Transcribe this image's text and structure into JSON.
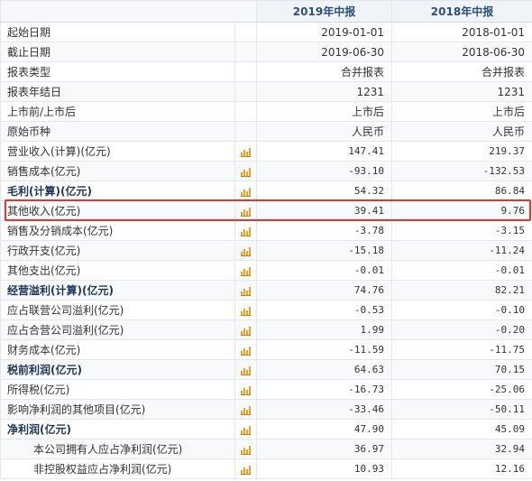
{
  "header": {
    "col1": "2019年中报",
    "col2": "2018年中报"
  },
  "rows": [
    {
      "label": "起始日期",
      "v1": "2019-01-01",
      "v2": "2018-01-01",
      "icon": false,
      "bold": false
    },
    {
      "label": "截止日期",
      "v1": "2019-06-30",
      "v2": "2018-06-30",
      "icon": false,
      "bold": false
    },
    {
      "label": "报表类型",
      "v1": "合并报表",
      "v2": "合并报表",
      "icon": false,
      "bold": false
    },
    {
      "label": "报表年结日",
      "v1": "1231",
      "v2": "1231",
      "icon": false,
      "bold": false
    },
    {
      "label": "上市前/上市后",
      "v1": "上市后",
      "v2": "上市后",
      "icon": false,
      "bold": false
    },
    {
      "label": "原始币种",
      "v1": "人民币",
      "v2": "人民币",
      "icon": false,
      "bold": false
    },
    {
      "label": "营业收入(计算)(亿元)",
      "v1": "147.41",
      "v2": "219.37",
      "icon": true,
      "bold": false
    },
    {
      "label": "销售成本(亿元)",
      "v1": "-93.10",
      "v2": "-132.53",
      "icon": true,
      "bold": false
    },
    {
      "label": "毛利(计算)(亿元)",
      "v1": "54.32",
      "v2": "86.84",
      "icon": true,
      "bold": true
    },
    {
      "label": "其他收入(亿元)",
      "v1": "39.41",
      "v2": "9.76",
      "icon": true,
      "bold": false
    },
    {
      "label": "销售及分销成本(亿元)",
      "v1": "-3.78",
      "v2": "-3.15",
      "icon": true,
      "bold": false
    },
    {
      "label": "行政开支(亿元)",
      "v1": "-15.18",
      "v2": "-11.24",
      "icon": true,
      "bold": false
    },
    {
      "label": "其他支出(亿元)",
      "v1": "-0.01",
      "v2": "-0.01",
      "icon": true,
      "bold": false
    },
    {
      "label": "经营溢利(计算)(亿元)",
      "v1": "74.76",
      "v2": "82.21",
      "icon": true,
      "bold": true
    },
    {
      "label": "应占联营公司溢利(亿元)",
      "v1": "-0.53",
      "v2": "-0.10",
      "icon": true,
      "bold": false
    },
    {
      "label": "应占合营公司溢利(亿元)",
      "v1": "1.99",
      "v2": "-0.20",
      "icon": true,
      "bold": false
    },
    {
      "label": "财务成本(亿元)",
      "v1": "-11.59",
      "v2": "-11.75",
      "icon": true,
      "bold": false
    },
    {
      "label": "税前利润(亿元)",
      "v1": "64.63",
      "v2": "70.15",
      "icon": true,
      "bold": true
    },
    {
      "label": "所得税(亿元)",
      "v1": "-16.73",
      "v2": "-25.06",
      "icon": true,
      "bold": false
    },
    {
      "label": "影响净利润的其他项目(亿元)",
      "v1": "-33.46",
      "v2": "-50.11",
      "icon": true,
      "bold": false
    },
    {
      "label": "净利润(亿元)",
      "v1": "47.90",
      "v2": "45.09",
      "icon": true,
      "bold": true
    },
    {
      "label": "本公司拥有人应占净利润(亿元)",
      "v1": "36.97",
      "v2": "32.94",
      "icon": true,
      "bold": false,
      "indent": true
    },
    {
      "label": "非控股权益应占净利润(亿元)",
      "v1": "10.93",
      "v2": "12.16",
      "icon": true,
      "bold": false,
      "indent": true
    }
  ],
  "colors": {
    "highlight": "#e8342a",
    "chart_icon": "#f0a12b",
    "header_text": "#2d4f78"
  }
}
